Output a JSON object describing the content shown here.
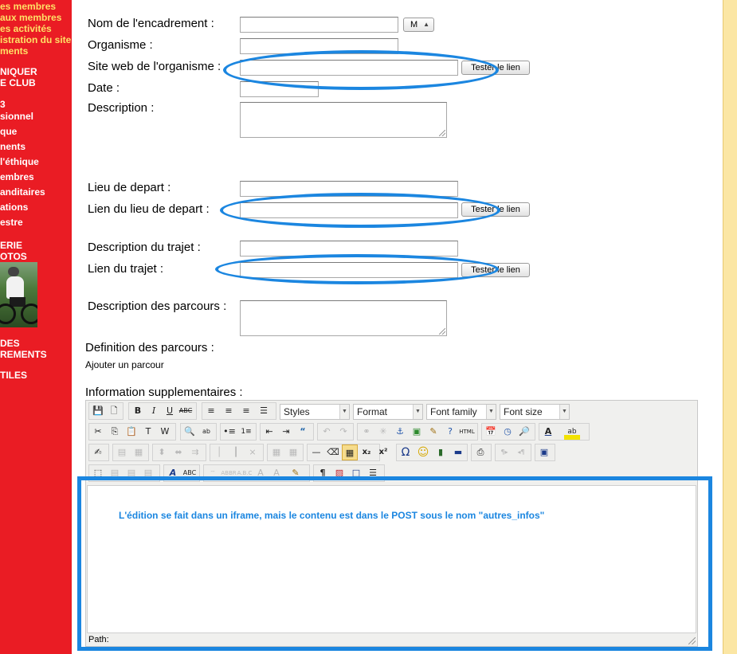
{
  "sidebar": {
    "links_top": [
      "es membres",
      "aux membres",
      "es activités",
      "istration du site",
      "ments"
    ],
    "section_communiquer": [
      "NIQUER",
      "E CLUB"
    ],
    "links_mid": [
      "3",
      "sionnel",
      "que",
      "nents",
      "l'éthique",
      "embres",
      "anditaires",
      "ations",
      "estre"
    ],
    "section_galerie": [
      "ERIE",
      "OTOS"
    ],
    "section_des": [
      "DES",
      "REMENTS"
    ],
    "section_utiles": "TILES"
  },
  "form": {
    "nom_label": "Nom de l'encadrement :",
    "nom_value": "",
    "civility_select": "M",
    "organisme_label": "Organisme :",
    "organisme_value": "",
    "site_label": "Site web de l'organisme :",
    "site_value": "",
    "test_button": "Tester le lien",
    "date_label": "Date :",
    "date_value": "",
    "description_label": "Description :",
    "lieu_label": "Lieu de depart :",
    "lien_lieu_label": "Lien du lieu de depart :",
    "desc_trajet_label": "Description du trajet :",
    "lien_trajet_label": "Lien du trajet :",
    "desc_parcours_label": "Description des parcours :",
    "def_parcours_label": "Definition des parcours :",
    "ajouter_parcours": "Ajouter un parcour",
    "info_sup_label": "Information supplementaires :"
  },
  "editor": {
    "styles_select": "Styles",
    "format_select": "Format",
    "font_family_select": "Font family",
    "font_size_select": "Font size",
    "path_label": "Path:"
  },
  "annotation": {
    "note": "L'édition se fait dans un iframe, mais le contenu est dans le POST sous le nom \"autres_infos\"",
    "color": "#1b86e0"
  },
  "colors": {
    "sidebar_bg": "#ea1c24",
    "sidebar_link": "#ffe066",
    "right_strip": "#fbe6a4"
  }
}
